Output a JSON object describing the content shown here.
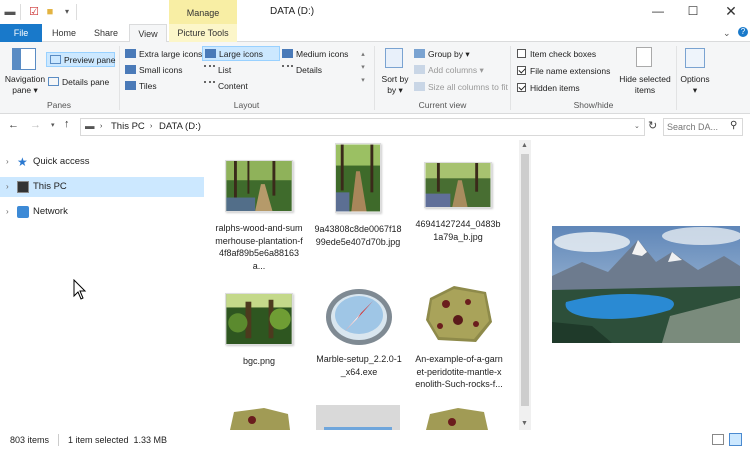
{
  "window": {
    "title": "DATA (D:)",
    "context_tab": "Manage"
  },
  "tabs": [
    {
      "label": "File"
    },
    {
      "label": "Home"
    },
    {
      "label": "Share"
    },
    {
      "label": "View"
    },
    {
      "label": "Picture Tools"
    }
  ],
  "ribbon": {
    "panes": {
      "navigation_pane": "Navigation pane",
      "preview_pane": "Preview pane",
      "details_pane": "Details pane",
      "group": "Panes"
    },
    "layout": {
      "items": [
        "Extra large icons",
        "Large icons",
        "Medium icons",
        "Small icons",
        "List",
        "Details",
        "Tiles",
        "Content"
      ],
      "selected": "Large icons",
      "group": "Layout"
    },
    "current_view": {
      "sort_by": "Sort by",
      "group_by": "Group by",
      "add_columns": "Add columns",
      "size_all_columns": "Size all columns to fit",
      "group": "Current view"
    },
    "show_hide": {
      "item_check_boxes": {
        "label": "Item check boxes",
        "checked": false
      },
      "file_name_extensions": {
        "label": "File name extensions",
        "checked": true
      },
      "hidden_items": {
        "label": "Hidden items",
        "checked": true
      },
      "hide_selected_items": "Hide selected items",
      "group": "Show/hide"
    },
    "options": "Options"
  },
  "address": {
    "path": [
      "This PC",
      "DATA (D:)"
    ],
    "search_placeholder": "Search DA..."
  },
  "nav": [
    {
      "label": "Quick access"
    },
    {
      "label": "This PC",
      "selected": true
    },
    {
      "label": "Network"
    }
  ],
  "files": [
    {
      "name": "ralphs-wood-and-summerhouse-plantation-f4f8af89b5e6a88163a..."
    },
    {
      "name": "9a43808c8de0067f1899ede5e407d70b.jpg"
    },
    {
      "name": "46941427244_0483b1a79a_b.jpg"
    },
    {
      "name": "bgc.png"
    },
    {
      "name": "Marble-setup_2.2.0-1_x64.exe"
    },
    {
      "name": "An-example-of-a-garnet-peridotite-mantle-xenolith-Such-rocks-f..."
    }
  ],
  "status": {
    "item_count": "803 items",
    "selection": "1 item selected  1.33 MB"
  },
  "colors": {
    "accent": "#1979ca",
    "selection": "#cce8ff",
    "manage": "#f8eea4"
  }
}
